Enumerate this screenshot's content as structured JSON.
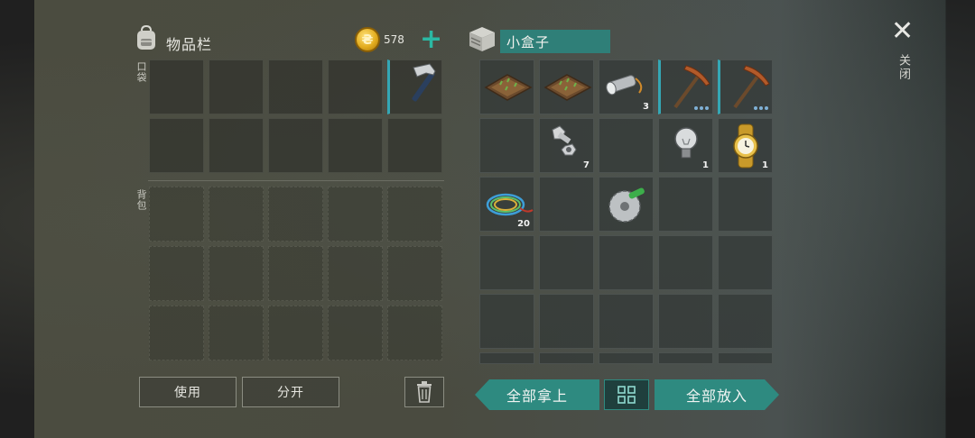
{
  "inventory": {
    "title": "物品栏",
    "coins": "578",
    "pocket_label": "口袋",
    "backpack_label": "背包"
  },
  "container": {
    "name": "小盒子"
  },
  "close": {
    "label": "关闭"
  },
  "pocket_items": [
    {
      "name": "hammer-icon",
      "qty": ""
    }
  ],
  "box_items": [
    {
      "name": "garden-bed-icon",
      "qty": ""
    },
    {
      "name": "garden-bed-icon",
      "qty": ""
    },
    {
      "name": "flashlight-icon",
      "qty": "3"
    },
    {
      "name": "pickaxe-icon",
      "qty": ""
    },
    {
      "name": "pickaxe-icon",
      "qty": ""
    },
    {
      "name": "bolt-nut-icon",
      "qty": "7"
    },
    {
      "name": "light-bulb-icon",
      "qty": "1"
    },
    {
      "name": "wristwatch-icon",
      "qty": "1"
    },
    {
      "name": "wire-coil-icon",
      "qty": "20"
    },
    {
      "name": "saw-blade-icon",
      "qty": ""
    }
  ],
  "buttons": {
    "use": "使用",
    "split": "分开",
    "take_all": "全部拿上",
    "put_all": "全部放入"
  },
  "colors": {
    "accent_teal": "#2e8a80",
    "coin_gold": "#e3ad1f",
    "slot_border_accent": "#34a7b5"
  }
}
